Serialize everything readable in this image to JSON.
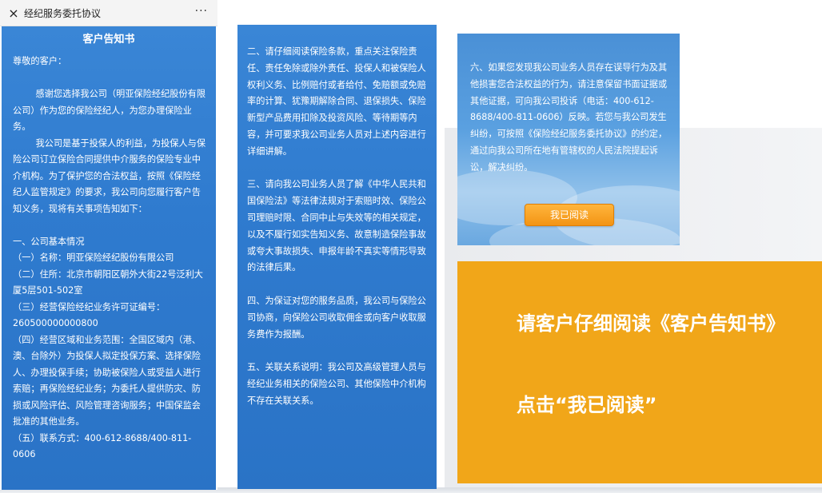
{
  "window": {
    "title": "经纪服务委托协议",
    "close_icon": "×",
    "more_icon": "···"
  },
  "panel1": {
    "doc_title": "客户告知书",
    "paragraphs": [
      "尊敬的客户：",
      "",
      "        感谢您选择我公司（明亚保险经纪股份有限公司）作为您的保险经纪人，为您办理保险业务。",
      "        我公司是基于投保人的利益，为投保人与保险公司订立保险合同提供中介服务的保险专业中介机构。为了保护您的合法权益，按照《保险经纪人监管规定》的要求，我公司向您履行客户告知义务，现将有关事项告知如下：",
      "",
      "一、公司基本情况",
      "（一）名称：明亚保险经纪股份有限公司",
      "（二）住所：北京市朝阳区朝外大街22号泛利大厦5层501-502室",
      "（三）经营保险经纪业务许可证编号：260500000000800",
      "（四）经营区域和业务范围：全国区域内（港、澳、台除外）为投保人拟定投保方案、选择保险人、办理投保手续；协助被保险人或受益人进行索赔；再保险经纪业务；为委托人提供防灾、防损或风险评估、风险管理咨询服务；中国保监会批准的其他业务。",
      "（五）联系方式：400-612-8688/400-811-0606"
    ]
  },
  "panel2": {
    "paragraphs": [
      "二、请仔细阅读保险条款，重点关注保险责任、责任免除或除外责任、投保人和被保险人权利义务、比例赔付或者给付、免赔额或免赔率的计算、犹豫期解除合同、退保损失、保险新型产品费用扣除及投资风险、等待期等内容，并可要求我公司业务人员对上述内容进行详细讲解。",
      "",
      "三、请向我公司业务人员了解《中华人民共和国保险法》等法律法规对于索赔时效、保险公司理赔时限、合同中止与失效等的相关规定，以及不履行如实告知义务、故意制造保险事故或夸大事故损失、申报年龄不真实等情形导致的法律后果。",
      "",
      "四、为保证对您的服务品质，我公司与保险公司协商，向保险公司收取佣金或向客户收取服务费作为报酬。",
      "",
      "五、关联关系说明：我公司及高级管理人员与经纪业务相关的保险公司、其他保险中介机构不存在关联关系。"
    ]
  },
  "panel3": {
    "paragraph": "六、如果您发现我公司业务人员存在误导行为及其他损害您合法权益的行为，请注意保留书面证据或其他证据，可向我公司投诉（电话：400-612-8688/400-811-0606）反映。若您与我公司发生纠纷，可按照《保险经纪服务委托协议》的约定，通过向我公司所在地有管辖权的人民法院提起诉讼，解决纠纷。",
    "read_button": "我已阅读"
  },
  "callout": {
    "line1": "请客户仔细阅读《客户告知书》",
    "line2": "点击“我已阅读”"
  },
  "colors": {
    "panel_blue": "#2f7bcf",
    "button_orange": "#f39414",
    "callout_orange": "#f1a619"
  }
}
